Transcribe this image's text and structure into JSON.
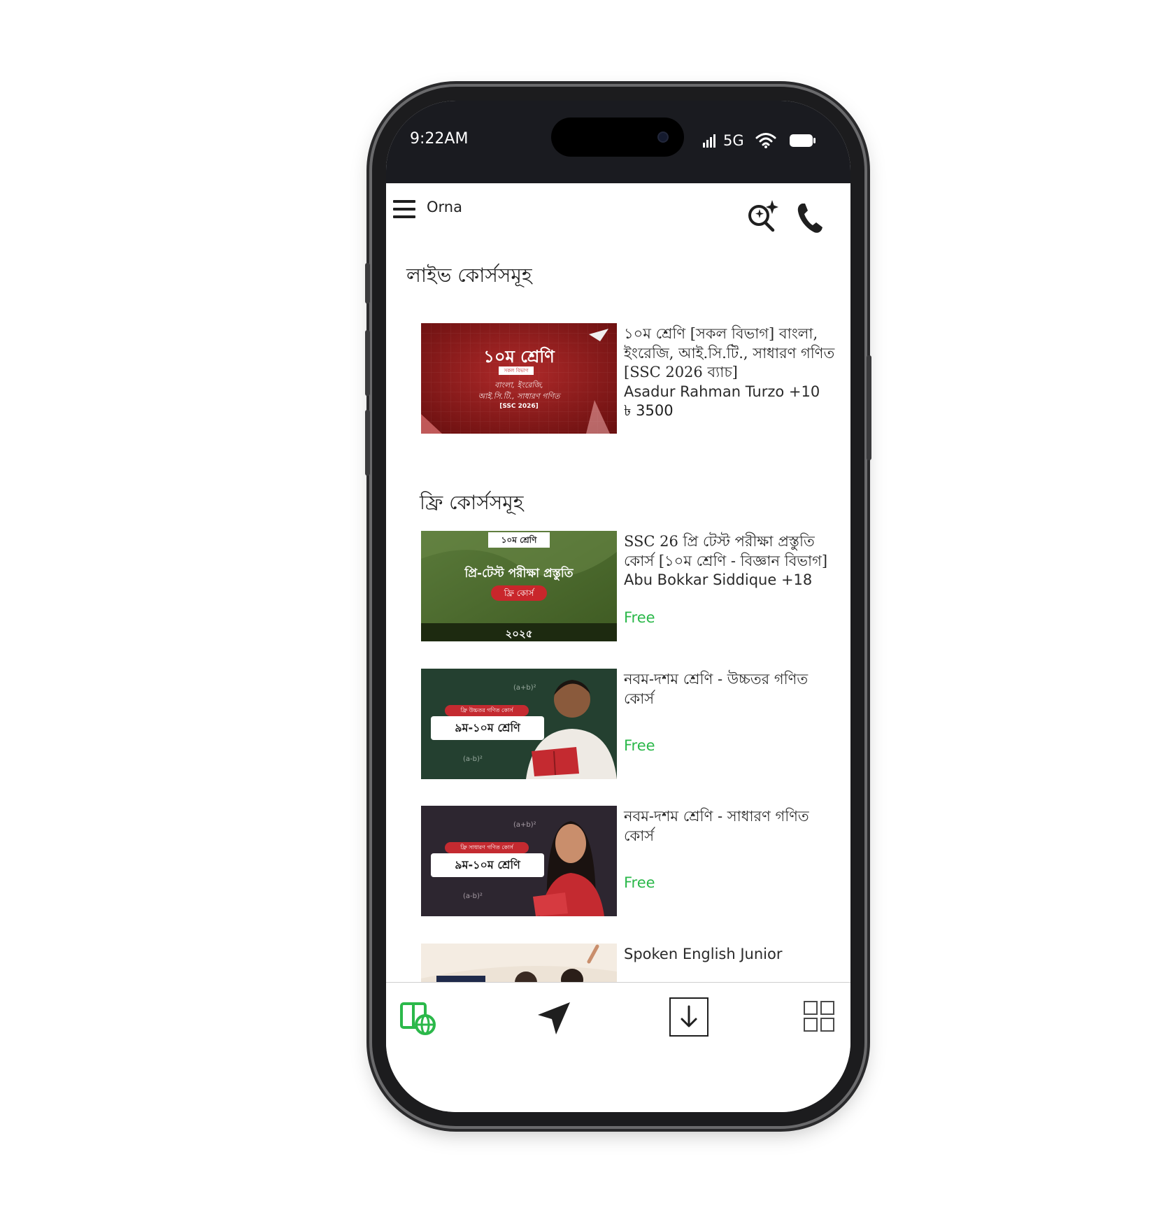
{
  "status": {
    "time": "9:22AM",
    "network": "5G"
  },
  "appbar": {
    "title": "Orna"
  },
  "sections": {
    "live_title": "লাইভ কোর্সসমূহ",
    "free_title": "ফ্রি কোর্সসমূহ"
  },
  "live_course": {
    "title": "১০ম শ্রেণি [সকল বিভাগ] বাংলা, ইংরেজি, আই.সি.টি., সাধারণ গণিত [SSC 2026 ব্যাচ]",
    "instructors": "Asadur Rahman Turzo +10",
    "price": "৳ 3500",
    "thumb": {
      "heading": "১০ম শ্রেণি",
      "tag": "সকল বিভাগ",
      "line1": "বাংলা, ইংরেজি,",
      "line2": "আই.সি.টি., সাধারণ গণিত",
      "line3": "[SSC 2026]"
    }
  },
  "free_courses": [
    {
      "title": "SSC 26 প্রি টেস্ট পরীক্ষা প্রস্তুতি কোর্স [১০ম শ্রেণি - বিজ্ঞান বিভাগ]",
      "instructors": "Abu Bokkar Siddique +18",
      "price": "Free",
      "thumb": {
        "badge": "১০ম শ্রেণি",
        "heading": "প্রি-টেস্ট পরীক্ষা প্রস্তুতি",
        "pill": "ফ্রি কোর্স",
        "year": "২০২৫"
      }
    },
    {
      "title": "নবম-দশম শ্রেণি - উচ্চতর গণিত কোর্স",
      "price": "Free",
      "thumb": {
        "tag": "ফ্রি উচ্চতর গণিত কোর্স",
        "label": "৯ম-১০ম শ্রেণি",
        "formula1": "(a+b)²",
        "formula2": "(a-b)²"
      }
    },
    {
      "title": "নবম-দশম শ্রেণি - সাধারণ গণিত কোর্স",
      "price": "Free",
      "thumb": {
        "tag": "ফ্রি সাধারণ গণিত কোর্স",
        "label": "৯ম-১০ম শ্রেণি",
        "formula1": "(a+b)²",
        "formula2": "(a-b)²"
      }
    },
    {
      "title": "Spoken English Junior"
    }
  ],
  "bottom_nav": [
    {
      "icon": "courses-globe-icon",
      "active": true
    },
    {
      "icon": "send-arrow-icon",
      "active": false
    },
    {
      "icon": "download-icon",
      "active": false
    },
    {
      "icon": "grid-menu-icon",
      "active": false
    }
  ],
  "colors": {
    "accent_green": "#2bb84a",
    "status_bar": "#1a1b20"
  }
}
